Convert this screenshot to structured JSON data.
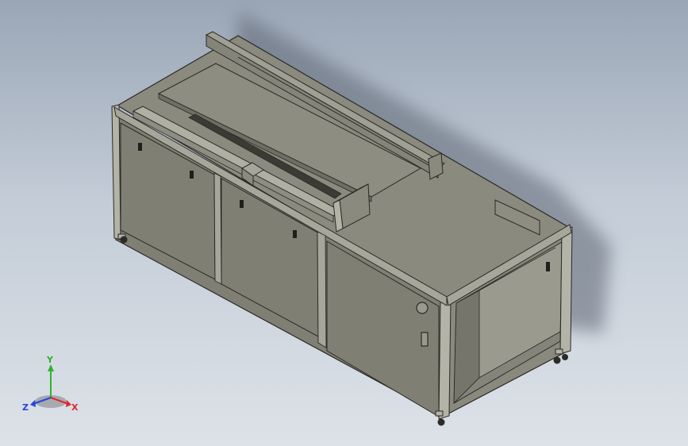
{
  "viewport": {
    "background_top": "#9aa6b6",
    "background_bottom": "#dde2e8"
  },
  "model": {
    "panel_color": "#7f7f74",
    "panel_dark": "#6e6e64",
    "top_color": "#8b8a7e",
    "frame_color": "#b4b3a8",
    "edge_color": "#2a2a25"
  },
  "triad": {
    "x_label": "X",
    "y_label": "Y",
    "z_label": "Z",
    "x_color": "#e0282c",
    "y_color": "#2db42d",
    "z_color": "#2845d8"
  }
}
